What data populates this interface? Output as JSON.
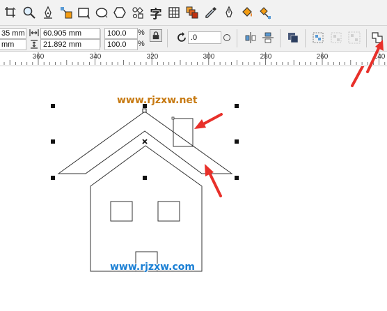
{
  "toolbox": {
    "tools": [
      {
        "name": "crop-icon"
      },
      {
        "name": "zoom-icon"
      },
      {
        "name": "freehand-pen-icon"
      },
      {
        "name": "smart-fill-icon"
      },
      {
        "name": "rectangle-icon"
      },
      {
        "name": "ellipse-icon"
      },
      {
        "name": "polygon-icon"
      },
      {
        "name": "basic-shapes-icon"
      },
      {
        "name": "text-tool-icon",
        "glyph": "字"
      },
      {
        "name": "table-icon"
      },
      {
        "name": "interactive-blend-icon"
      },
      {
        "name": "eyedropper-icon"
      },
      {
        "name": "outline-pen-icon"
      },
      {
        "name": "fill-bucket-icon"
      },
      {
        "name": "interactive-fill-icon"
      }
    ]
  },
  "property_bar": {
    "x_position": "35 mm",
    "y_position": "mm",
    "width": "60.905 mm",
    "height": "21.892 mm",
    "scale_x": "100.0",
    "scale_y": "100.0",
    "percent": "%",
    "rotation": ".0",
    "icons": [
      "lock-ratio-icon",
      "rotate-icon",
      "rotation-unit-icon",
      "mirror-horizontal-icon",
      "mirror-vertical-icon",
      "arrange-front-icon",
      "group-icon",
      "ungroup-icon",
      "ungroup-all-icon",
      "weld-icon"
    ]
  },
  "ruler": {
    "labels": [
      "360",
      "340",
      "320",
      "300",
      "280",
      "260",
      "240"
    ]
  },
  "canvas": {
    "watermark_top": "www.rjzxw.net",
    "watermark_bottom": "www.rjzxw.com",
    "annotation_color": "#e8302a"
  }
}
